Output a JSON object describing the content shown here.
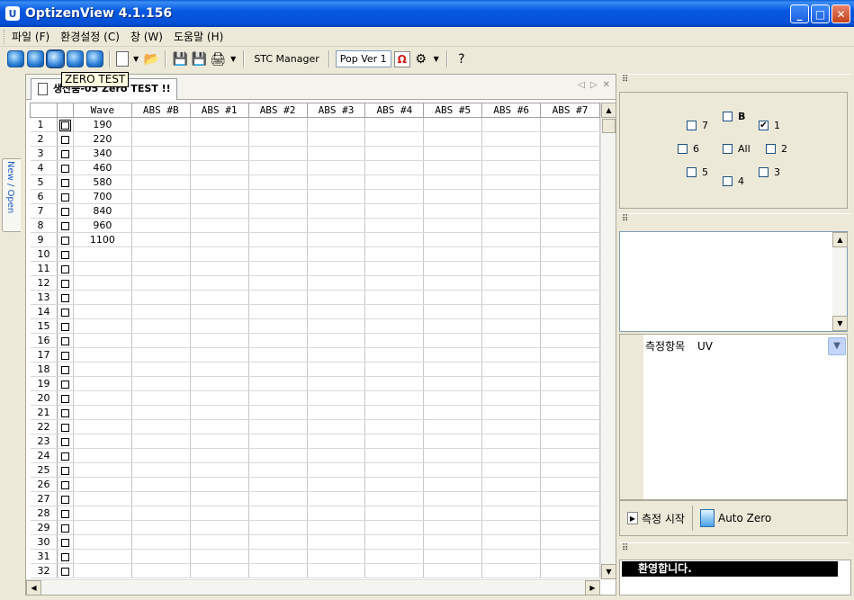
{
  "window": {
    "title": "OptizenView 4.1.156",
    "app_icon": "U"
  },
  "menu": [
    "파일 (F)",
    "환경설정 (C)",
    "창 (W)",
    "도움말 (H)"
  ],
  "toolbar": {
    "stc_manager": "STC Manager",
    "pop_ver": "Pop Ver 1"
  },
  "tooltip": "ZERO TEST",
  "side_tab": "New / Open",
  "doc_tab": {
    "title": "생산품-05 Zero TEST !!"
  },
  "grid": {
    "headers": [
      "Wave",
      "ABS #B",
      "ABS #1",
      "ABS #2",
      "ABS #3",
      "ABS #4",
      "ABS #5",
      "ABS #6",
      "ABS #7"
    ],
    "waves": [
      "190",
      "220",
      "340",
      "460",
      "580",
      "700",
      "840",
      "960",
      "1100"
    ],
    "row_count": 32
  },
  "channels": {
    "items": [
      {
        "label": "7",
        "checked": false
      },
      {
        "label": "B",
        "checked": false
      },
      {
        "label": "1",
        "checked": true
      },
      {
        "label": "6",
        "checked": false
      },
      {
        "label": "All",
        "checked": false
      },
      {
        "label": "2",
        "checked": false
      },
      {
        "label": "5",
        "checked": false
      },
      {
        "label": "4",
        "checked": false
      },
      {
        "label": "3",
        "checked": false
      }
    ]
  },
  "props": {
    "label": "측정항목",
    "value": "UV"
  },
  "actions": {
    "start": "측정 시작",
    "auto_zero": "Auto Zero"
  },
  "status": {
    "welcome": "환영합니다."
  }
}
